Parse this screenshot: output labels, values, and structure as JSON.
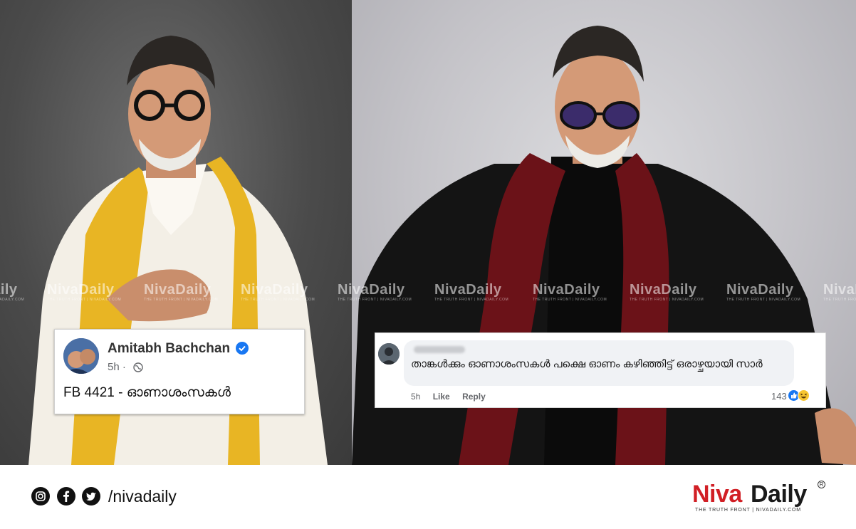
{
  "watermark": {
    "brand": "NivaDaily",
    "tagline": "THE TRUTH FRONT | NIVADAILY.COM"
  },
  "post": {
    "author": "Amitabh Bachchan",
    "time": "5h",
    "separator": "·",
    "text": "FB 4421 - ഓണാശംസകൾ"
  },
  "comment": {
    "text": "താങ്കൾക്കും ഓണാശംസകൾ പക്ഷെ ഓണം കഴിഞ്ഞിട്ട് ഒരാഴ്ചയായി സാർ",
    "time": "5h",
    "like_label": "Like",
    "reply_label": "Reply",
    "reaction_count": "143"
  },
  "footer": {
    "social_handle": "/nivadaily",
    "brand_part1": "Niva",
    "brand_part2": "Daily",
    "tagline": "THE TRUTH FRONT | NIVADAILY.COM",
    "registered": "R"
  },
  "colors": {
    "brand_red": "#d11f25",
    "facebook_blue": "#1877f2",
    "verified_blue": "#1877f2"
  },
  "icons": [
    "instagram-icon",
    "facebook-icon",
    "twitter-icon",
    "verified-icon",
    "globe-icon",
    "like-reaction-icon",
    "haha-reaction-icon"
  ]
}
